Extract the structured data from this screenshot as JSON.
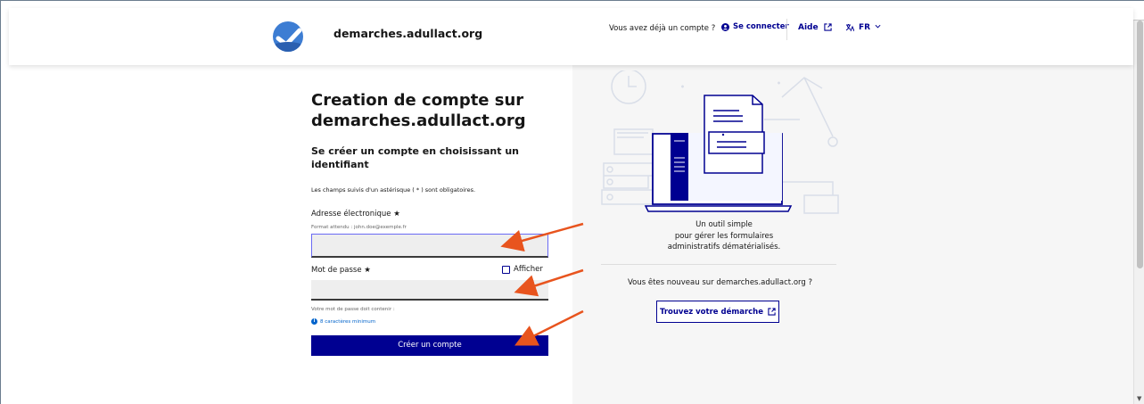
{
  "header": {
    "site_name": "demarches.adullact.org",
    "has_account": "Vous avez déjà un compte ?",
    "login_label": "Se connecter",
    "help_label": "Aide",
    "lang_label": "FR"
  },
  "form": {
    "title_line1": "Creation de compte sur",
    "title_line2": "demarches.adullact.org",
    "subtitle_line1": "Se créer un compte en choisissant un",
    "subtitle_line2": "identifiant",
    "mandatory_note": "Les champs suivis d'un astérisque ( * ) sont obligatoires.",
    "email_label": "Adresse électronique",
    "email_hint": "Format attendu : john.doe@exemple.fr",
    "email_value": "",
    "password_label": "Mot de passe",
    "password_value": "",
    "show_password_label": "Afficher",
    "password_rules_title": "Votre mot de passe doit contenir :",
    "password_rule_min": "8 caractères minimum",
    "submit_label": "Créer un compte"
  },
  "aside": {
    "tagline_line1": "Un outil simple",
    "tagline_line2": "pour gérer les formulaires",
    "tagline_line3": "administratifs dématérialisés.",
    "new_here": "Vous êtes nouveau sur demarches.adullact.org ?",
    "find_button": "Trouvez votre démarche"
  },
  "colors": {
    "primary": "#000091",
    "arrow": "#e8541e",
    "panel_bg": "#f6f6f6"
  }
}
